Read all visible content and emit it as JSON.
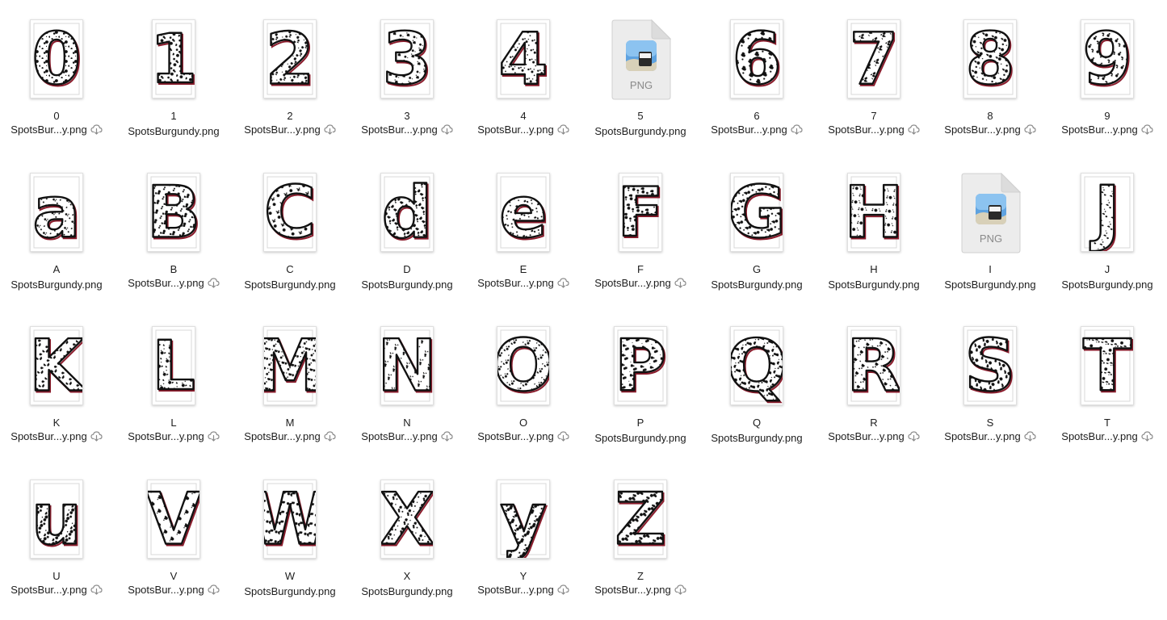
{
  "files": [
    {
      "label": "0",
      "filename": "SpotsBur...y.png",
      "cloud": true,
      "glyph": "0",
      "icon": "image-thumbnail"
    },
    {
      "label": "1",
      "filename": "SpotsBurgundy.png",
      "cloud": false,
      "glyph": "1",
      "icon": "image-thumbnail"
    },
    {
      "label": "2",
      "filename": "SpotsBur...y.png",
      "cloud": true,
      "glyph": "2",
      "icon": "image-thumbnail"
    },
    {
      "label": "3",
      "filename": "SpotsBur...y.png",
      "cloud": true,
      "glyph": "3",
      "icon": "image-thumbnail"
    },
    {
      "label": "4",
      "filename": "SpotsBur...y.png",
      "cloud": true,
      "glyph": "4",
      "icon": "image-thumbnail"
    },
    {
      "label": "5",
      "filename": "SpotsBurgundy.png",
      "cloud": false,
      "glyph": "",
      "icon": "png-file-icon",
      "icon_text": "PNG"
    },
    {
      "label": "6",
      "filename": "SpotsBur...y.png",
      "cloud": true,
      "glyph": "6",
      "icon": "image-thumbnail"
    },
    {
      "label": "7",
      "filename": "SpotsBur...y.png",
      "cloud": true,
      "glyph": "7",
      "icon": "image-thumbnail"
    },
    {
      "label": "8",
      "filename": "SpotsBur...y.png",
      "cloud": true,
      "glyph": "8",
      "icon": "image-thumbnail"
    },
    {
      "label": "9",
      "filename": "SpotsBur...y.png",
      "cloud": true,
      "glyph": "9",
      "icon": "image-thumbnail"
    },
    {
      "label": "A",
      "filename": "SpotsBurgundy.png",
      "cloud": false,
      "glyph": "a",
      "icon": "image-thumbnail"
    },
    {
      "label": "B",
      "filename": "SpotsBur...y.png",
      "cloud": true,
      "glyph": "B",
      "icon": "image-thumbnail"
    },
    {
      "label": "C",
      "filename": "SpotsBurgundy.png",
      "cloud": false,
      "glyph": "C",
      "icon": "image-thumbnail"
    },
    {
      "label": "D",
      "filename": "SpotsBurgundy.png",
      "cloud": false,
      "glyph": "d",
      "icon": "image-thumbnail"
    },
    {
      "label": "E",
      "filename": "SpotsBur...y.png",
      "cloud": true,
      "glyph": "e",
      "icon": "image-thumbnail"
    },
    {
      "label": "F",
      "filename": "SpotsBur...y.png",
      "cloud": true,
      "glyph": "F",
      "icon": "image-thumbnail"
    },
    {
      "label": "G",
      "filename": "SpotsBurgundy.png",
      "cloud": false,
      "glyph": "G",
      "icon": "image-thumbnail"
    },
    {
      "label": "H",
      "filename": "SpotsBurgundy.png",
      "cloud": false,
      "glyph": "H",
      "icon": "image-thumbnail"
    },
    {
      "label": "I",
      "filename": "SpotsBurgundy.png",
      "cloud": false,
      "glyph": "",
      "icon": "png-file-icon",
      "icon_text": "PNG"
    },
    {
      "label": "J",
      "filename": "SpotsBurgundy.png",
      "cloud": false,
      "glyph": "J",
      "icon": "image-thumbnail"
    },
    {
      "label": "K",
      "filename": "SpotsBur...y.png",
      "cloud": true,
      "glyph": "K",
      "icon": "image-thumbnail"
    },
    {
      "label": "L",
      "filename": "SpotsBur...y.png",
      "cloud": true,
      "glyph": "L",
      "icon": "image-thumbnail"
    },
    {
      "label": "M",
      "filename": "SpotsBur...y.png",
      "cloud": true,
      "glyph": "M",
      "icon": "image-thumbnail"
    },
    {
      "label": "N",
      "filename": "SpotsBur...y.png",
      "cloud": true,
      "glyph": "N",
      "icon": "image-thumbnail"
    },
    {
      "label": "O",
      "filename": "SpotsBur...y.png",
      "cloud": true,
      "glyph": "O",
      "icon": "image-thumbnail"
    },
    {
      "label": "P",
      "filename": "SpotsBurgundy.png",
      "cloud": false,
      "glyph": "P",
      "icon": "image-thumbnail"
    },
    {
      "label": "Q",
      "filename": "SpotsBurgundy.png",
      "cloud": false,
      "glyph": "Q",
      "icon": "image-thumbnail"
    },
    {
      "label": "R",
      "filename": "SpotsBur...y.png",
      "cloud": true,
      "glyph": "R",
      "icon": "image-thumbnail"
    },
    {
      "label": "S",
      "filename": "SpotsBur...y.png",
      "cloud": true,
      "glyph": "S",
      "icon": "image-thumbnail"
    },
    {
      "label": "T",
      "filename": "SpotsBur...y.png",
      "cloud": true,
      "glyph": "T",
      "icon": "image-thumbnail"
    },
    {
      "label": "U",
      "filename": "SpotsBur...y.png",
      "cloud": true,
      "glyph": "u",
      "icon": "image-thumbnail"
    },
    {
      "label": "V",
      "filename": "SpotsBur...y.png",
      "cloud": true,
      "glyph": "V",
      "icon": "image-thumbnail"
    },
    {
      "label": "W",
      "filename": "SpotsBurgundy.png",
      "cloud": false,
      "glyph": "W",
      "icon": "image-thumbnail"
    },
    {
      "label": "X",
      "filename": "SpotsBurgundy.png",
      "cloud": false,
      "glyph": "X",
      "icon": "image-thumbnail"
    },
    {
      "label": "Y",
      "filename": "SpotsBur...y.png",
      "cloud": true,
      "glyph": "y",
      "icon": "image-thumbnail"
    },
    {
      "label": "Z",
      "filename": "SpotsBur...y.png",
      "cloud": true,
      "glyph": "Z",
      "icon": "image-thumbnail"
    }
  ],
  "colors": {
    "text": "#1d1d1d",
    "outline": "#111111",
    "accent_burgundy": "#8b1c2c",
    "cloud_icon": "#8a8a8a",
    "thumb_border": "#e0e0e0"
  }
}
